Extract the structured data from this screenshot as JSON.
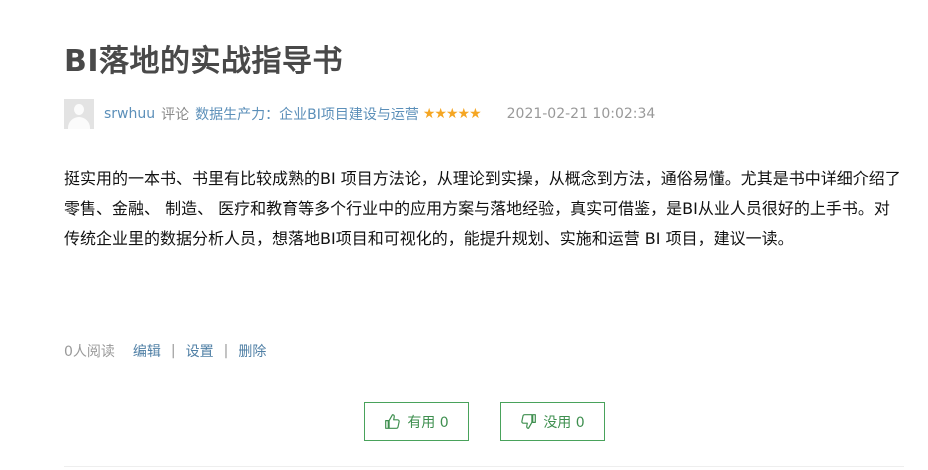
{
  "review": {
    "title": "BI落地的实战指导书",
    "author": "srwhuu",
    "action": "评论",
    "book_title": "数据生产力：企业BI项目建设与运营",
    "stars": "★★★★★",
    "rating": 5,
    "date": "2021-02-21 10:02:34",
    "content": "挺实用的一本书、书里有比较成熟的BI 项目方法论，从理论到实操，从概念到方法，通俗易懂。尤其是书中详细介绍了零售、金融、 制造、 医疗和教育等多个行业中的应用方案与落地经验，真实可借鉴，是BI从业人员很好的上手书。对传统企业里的数据分析人员，想落地BI项目和可视化的，能提升规划、实施和运营 BI 项目，建议一读。"
  },
  "footer": {
    "reads": "0人阅读",
    "edit": "编辑",
    "settings": "设置",
    "delete": "删除",
    "separator": "|"
  },
  "votes": {
    "useful_label": "有用 0",
    "useless_label": "没用 0"
  },
  "colors": {
    "title": "#494949",
    "link": "#5b8fb9",
    "star": "#f5a623",
    "button_border": "#49a25b"
  }
}
